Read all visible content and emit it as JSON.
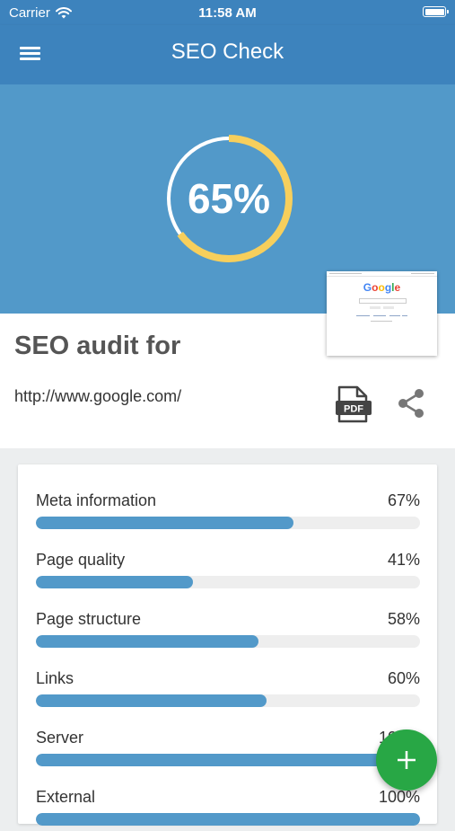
{
  "status_bar": {
    "carrier": "Carrier",
    "time": "11:58 AM",
    "icons": [
      "wifi-icon",
      "battery-icon"
    ]
  },
  "app_bar": {
    "title": "SEO Check",
    "menu_icon": "menu-icon"
  },
  "score": {
    "value": 0.65,
    "label": "65%",
    "ring_color": "#f7cf5c"
  },
  "audit": {
    "title": "SEO audit for",
    "url": "http://www.google.com/",
    "pdf_icon_label": "PDF",
    "share_icon": "share-icon"
  },
  "thumbnail": {
    "logo_letters": [
      "G",
      "o",
      "o",
      "g",
      "l",
      "e"
    ]
  },
  "metrics": [
    {
      "label": "Meta information",
      "value": "67%",
      "fraction": 0.67
    },
    {
      "label": "Page quality",
      "value": "41%",
      "fraction": 0.41
    },
    {
      "label": "Page structure",
      "value": "58%",
      "fraction": 0.58
    },
    {
      "label": "Links",
      "value": "60%",
      "fraction": 0.6
    },
    {
      "label": "Server",
      "value": "100%",
      "fraction": 1.0
    },
    {
      "label": "External",
      "value": "100%",
      "fraction": 1.0
    }
  ],
  "fab": {
    "icon": "plus-icon"
  },
  "colors": {
    "primary": "#3d83bd",
    "hero": "#5299c9",
    "bar": "#5299c9",
    "accent": "#f7cf5c",
    "fab": "#28a745"
  }
}
